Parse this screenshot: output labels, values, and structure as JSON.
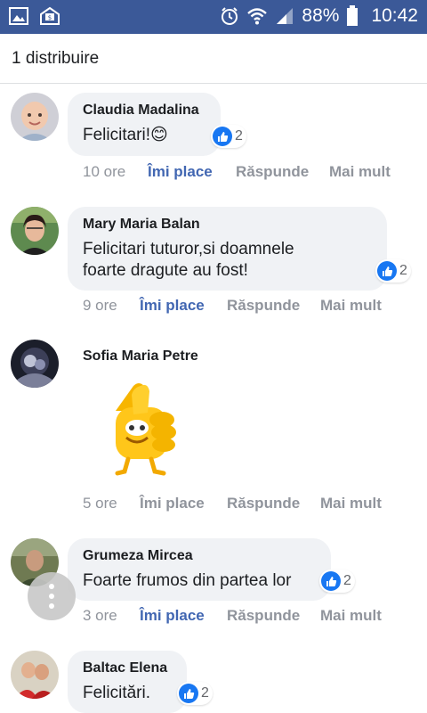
{
  "status_bar": {
    "battery": "88%",
    "time": "10:42"
  },
  "shares": {
    "label": "1 distribuire"
  },
  "comments": [
    {
      "author": "Claudia Madalina",
      "text": "Felicitari!😊",
      "reactions": "2",
      "time": "10 ore",
      "like": "Îmi place",
      "reply": "Răspunde",
      "more": "Mai mult"
    },
    {
      "author": "Mary Maria Balan",
      "text_line1": "Felicitari tuturor,si doamnele",
      "text_line2": "foarte dragute au fost!",
      "reactions": "2",
      "time": "9 ore",
      "like": "Îmi place",
      "reply": "Răspunde",
      "more": "Mai mult"
    },
    {
      "author": "Sofia Maria Petre",
      "sticker": "thumbs-up-sticker",
      "time": "5 ore",
      "like": "Îmi place",
      "reply": "Răspunde",
      "more": "Mai mult"
    },
    {
      "author": "Grumeza Mircea",
      "text": "Foarte frumos din partea lor",
      "reactions": "2",
      "time": "3 ore",
      "like": "Îmi place",
      "reply": "Răspunde",
      "more": "Mai mult"
    },
    {
      "author": "Baltac Elena",
      "text": "Felicitări.",
      "reactions": "2"
    }
  ],
  "colors": {
    "status_bar": "#3b5998",
    "like_blue": "#1877f2",
    "bubble": "#f0f2f5"
  }
}
